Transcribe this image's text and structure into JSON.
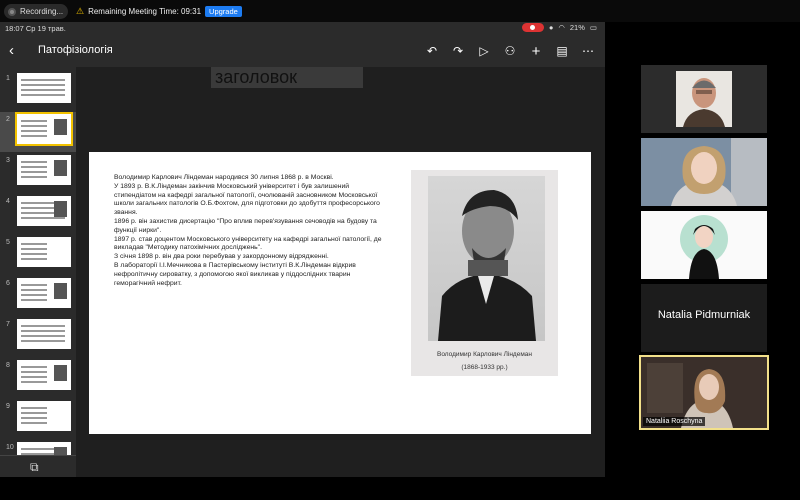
{
  "meeting": {
    "recording_label": "Recording...",
    "timer_label": "Remaining Meeting Time: 09:31",
    "upgrade_label": "Upgrade"
  },
  "status_bar": {
    "time": "18:07",
    "date": "Ср 19 трав.",
    "battery": "21%"
  },
  "app": {
    "title": "Патофізіологія",
    "toolbar": {
      "undo_icon": "undo-icon",
      "redo_icon": "redo-icon",
      "play_icon": "play-icon",
      "add_person_icon": "add-person-icon",
      "add_icon": "plus-icon",
      "comment_icon": "comment-icon",
      "more_icon": "more-icon"
    }
  },
  "sidebar": {
    "slides": [
      "1",
      "2",
      "3",
      "4",
      "5",
      "6",
      "7",
      "8",
      "9",
      "10"
    ],
    "selected": "2"
  },
  "canvas": {
    "prev_title": "заголовок",
    "slide": {
      "text": "Володимир Карлович Ліндеман народився 30 липня 1868 р. в Москві.\nУ 1893 р. В.К.Ліндеман закінчив Московський університет і був залишений стипендіатом на кафедрі загальної патології, очолюваній засновником Московської школи загальних патологів О.Б.Фохтом, для підготовки до здобуття професорського звання.\n1896 р. він захистив дисертацію \"Про вплив перев'язування сечоводів на будову та функції нирки\".\n1897 р. став доцентом  Московського університету на кафедрі загальної патології, де викладав \"Методику патохімічних досліджень\".\nЗ січня 1898 р. він два роки перебував у закордонному відрядженні.\nВ лабораторії І.І.Мечникова в Пастерівському інституті В.К.Ліндеман відкрив нефролітичну сироватку, з допомогою якої викликав у піддослідних тварин геморагічний нефрит.",
      "caption_name": "Володимир Карлович Ліндеман",
      "caption_years": "(1868-1933 рр.)"
    }
  },
  "participants": [
    {
      "name": "",
      "kind": "video"
    },
    {
      "name": "",
      "kind": "video"
    },
    {
      "name": "",
      "kind": "avatar"
    },
    {
      "name": "Natalia Pidmurniak",
      "kind": "name-only"
    },
    {
      "name": "Nataliia Roschyna",
      "kind": "video",
      "active": true
    }
  ]
}
